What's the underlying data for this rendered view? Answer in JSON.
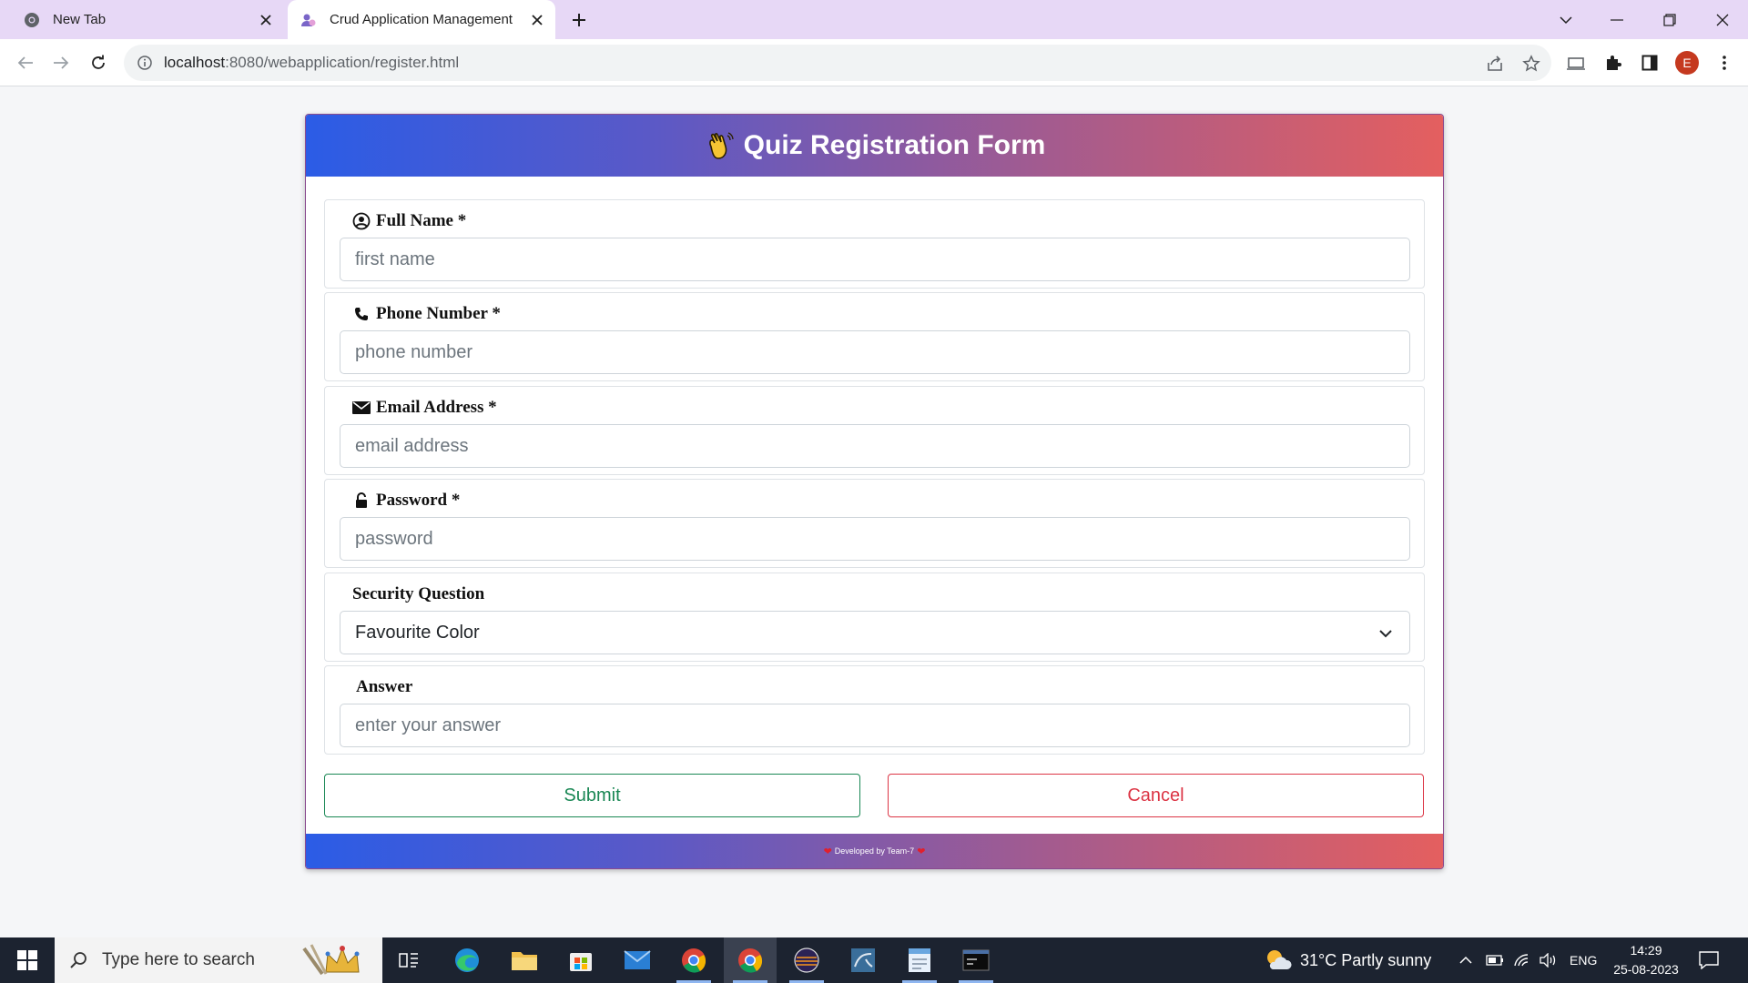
{
  "browser": {
    "tabs": [
      {
        "title": "New Tab",
        "active": false
      },
      {
        "title": "Crud Application Management",
        "active": true
      }
    ],
    "url_host": "localhost",
    "url_rest": ":8080/webapplication/register.html",
    "profile_initial": "E"
  },
  "form": {
    "title": "Quiz Registration Form",
    "fields": [
      {
        "label": "Full Name *",
        "placeholder": "first name",
        "icon": "user-circle-icon"
      },
      {
        "label": "Phone Number *",
        "placeholder": "phone number",
        "icon": "phone-icon"
      },
      {
        "label": "Email Address *",
        "placeholder": "email address",
        "icon": "envelope-icon"
      },
      {
        "label": "Password *",
        "placeholder": "password",
        "icon": "lock-icon"
      },
      {
        "label": "Security Question",
        "selected": "Favourite Color"
      },
      {
        "label": "Answer",
        "placeholder": "enter your answer"
      }
    ],
    "submit_label": "Submit",
    "cancel_label": "Cancel",
    "footer": "Developed by Team-7",
    "accent_colors": {
      "gradient_start": "#2b5ce6",
      "gradient_end": "#e45f5f",
      "submit": "#198754",
      "cancel": "#dc3545"
    }
  },
  "taskbar": {
    "search_placeholder": "Type here to search",
    "weather": "31°C  Partly sunny",
    "language": "ENG",
    "time": "14:29",
    "date": "25-08-2023"
  }
}
